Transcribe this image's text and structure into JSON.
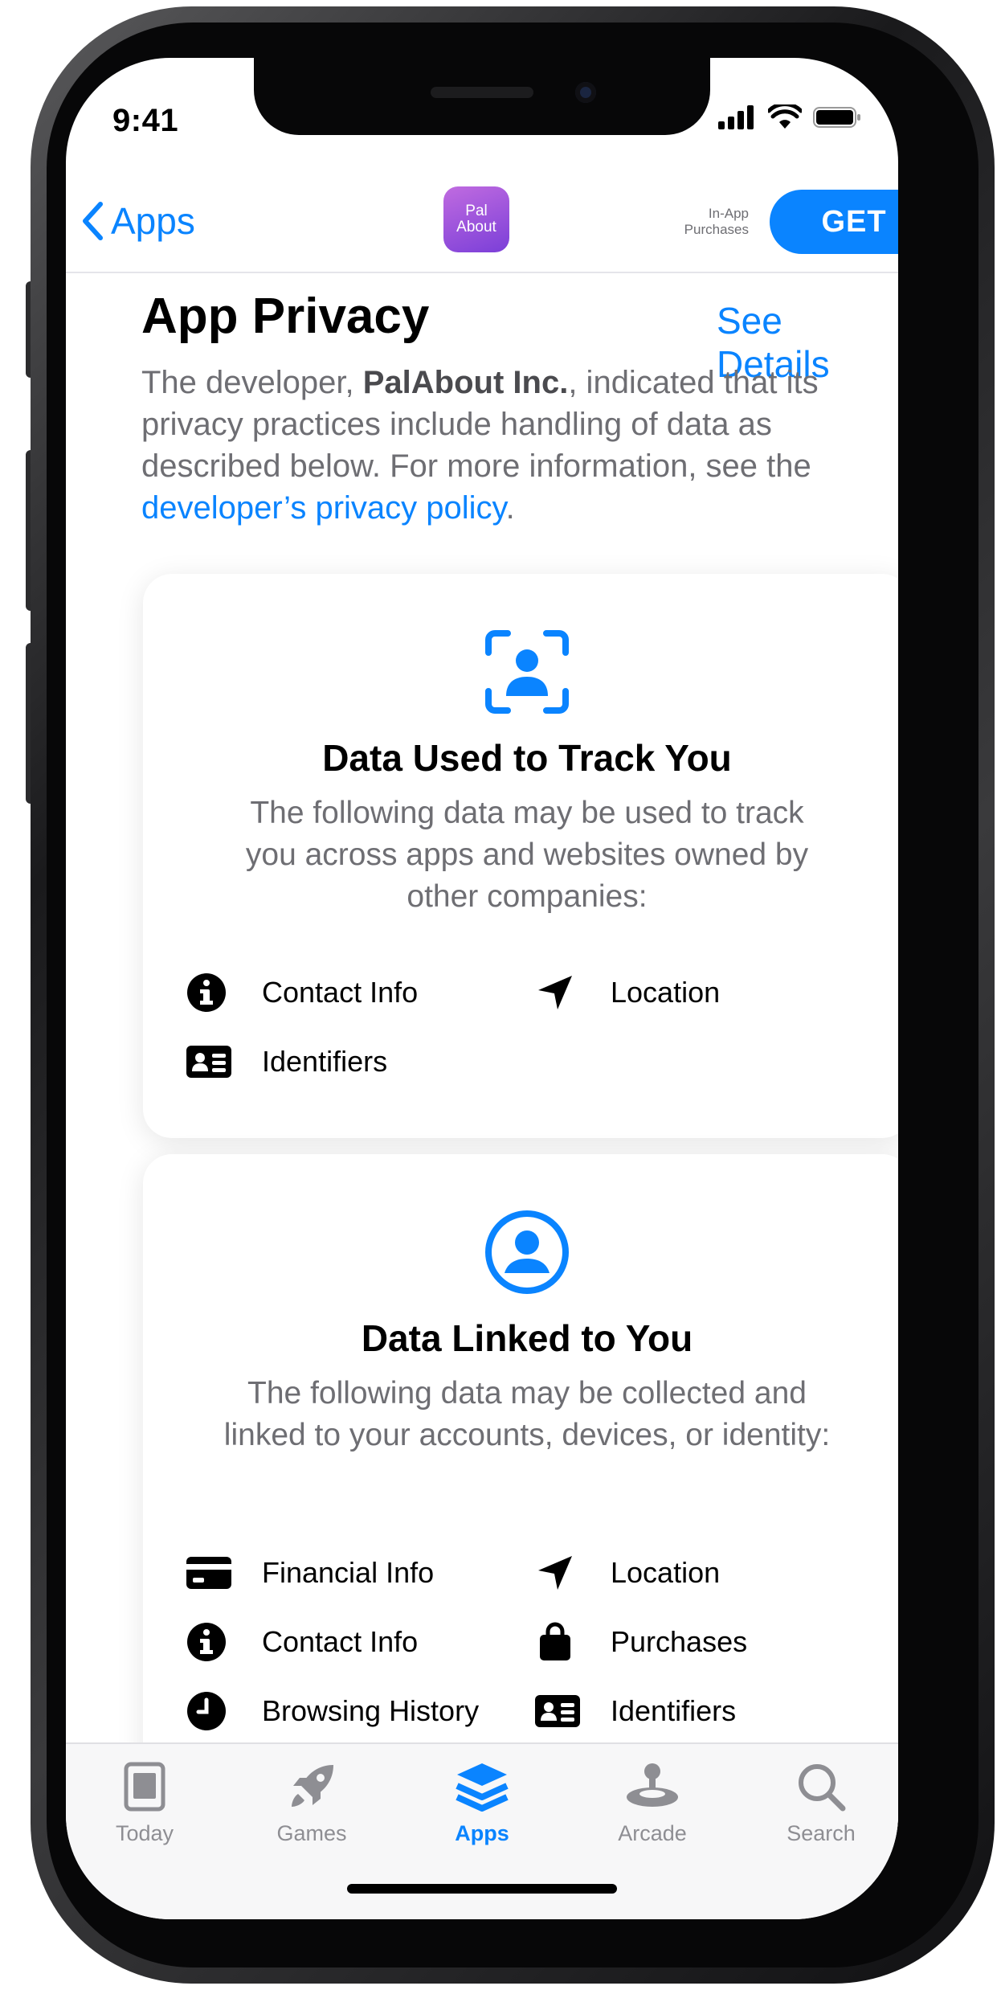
{
  "status_bar": {
    "time": "9:41"
  },
  "nav": {
    "back_label": "Apps",
    "app_icon_line1": "Pal",
    "app_icon_line2": "About",
    "iap_line1": "In-App",
    "iap_line2": "Purchases",
    "get_label": "GET"
  },
  "privacy": {
    "title": "App Privacy",
    "see_details": "See Details",
    "intro_prefix": "The developer, ",
    "developer": "PalAbout Inc.",
    "intro_middle": ", indicated that its privacy practices include handling of data as described below. For more information, see the ",
    "policy_link": "developer’s privacy policy",
    "intro_suffix": "."
  },
  "cards": {
    "track": {
      "title": "Data Used to Track You",
      "description": "The following data may be used to track you across apps and websites owned by other companies:",
      "items": [
        "Contact Info",
        "Location",
        "Identifiers"
      ]
    },
    "linked": {
      "title": "Data Linked to You",
      "description": "The following data may be collected and linked to your accounts, devices, or identity:",
      "items": [
        "Financial Info",
        "Location",
        "Contact Info",
        "Purchases",
        "Browsing History",
        "Identifiers"
      ]
    }
  },
  "tabbar": {
    "tabs": [
      {
        "label": "Today",
        "icon": "today-icon"
      },
      {
        "label": "Games",
        "icon": "rocket-icon"
      },
      {
        "label": "Apps",
        "icon": "stack-icon"
      },
      {
        "label": "Arcade",
        "icon": "joystick-icon"
      },
      {
        "label": "Search",
        "icon": "search-icon"
      }
    ],
    "active_tab": "Apps"
  },
  "colors": {
    "accent": "#0a84ff",
    "secondary_text": "#6e6e73"
  }
}
